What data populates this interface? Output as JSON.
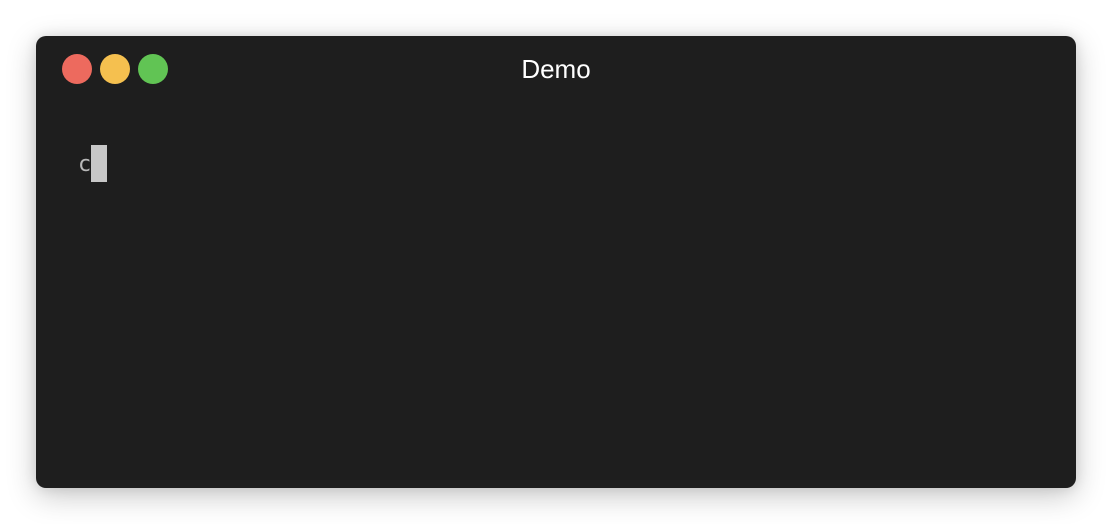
{
  "window": {
    "title": "Demo",
    "background": "#1e1e1e",
    "controls": [
      {
        "name": "close",
        "color": "#ed6a5e"
      },
      {
        "name": "minimize",
        "color": "#f5c04f"
      },
      {
        "name": "zoom",
        "color": "#61c454"
      }
    ]
  },
  "terminal": {
    "lines": [
      {
        "text": "c"
      }
    ],
    "text_color": "#b8b8b8",
    "cursor_color": "#c8c8c8"
  }
}
